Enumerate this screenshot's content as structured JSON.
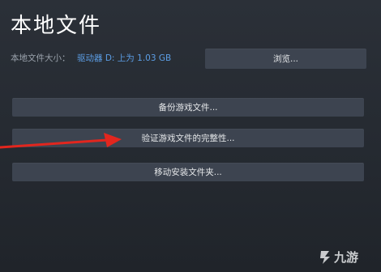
{
  "page": {
    "title": "本地文件"
  },
  "local_files": {
    "size_label": "本地文件大小：",
    "size_value": "驱动器 D: 上为 1.03 GB"
  },
  "buttons": {
    "browse": "浏览...",
    "backup": "备份游戏文件...",
    "verify": "验证游戏文件的完整性...",
    "move": "移动安装文件夹..."
  },
  "annotation": {
    "arrow_color": "#e2261e"
  },
  "watermark": {
    "text": "九游"
  }
}
